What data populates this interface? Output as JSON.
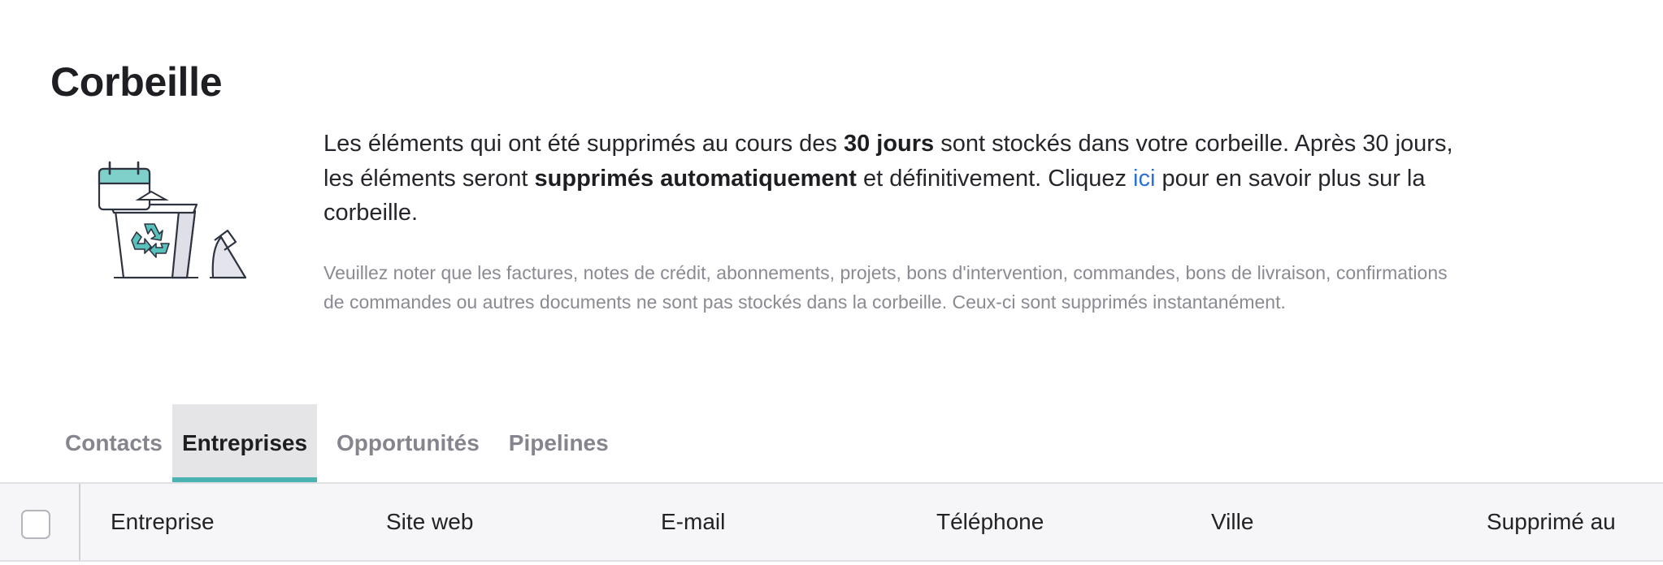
{
  "page": {
    "title": "Corbeille"
  },
  "intro": {
    "text_1": "Les éléments qui ont été supprimés au cours des ",
    "bold_1": "30 jours",
    "text_2": " sont stockés dans votre corbeille. Après 30 jours, les éléments seront ",
    "bold_2": "supprimés automatiquement",
    "text_3": " et définitivement. Cliquez ",
    "link": "ici",
    "text_4": " pour en savoir plus sur la corbeille."
  },
  "note": {
    "text": "Veuillez noter que les factures, notes de crédit, abonnements, projets, bons d'intervention, commandes, bons de livraison, confirmations de commandes ou autres documents ne sont pas stockés dans la corbeille. Ceux-ci sont supprimés instantanément."
  },
  "tabs": [
    {
      "label": "Contacts",
      "active": false
    },
    {
      "label": "Entreprises",
      "active": true
    },
    {
      "label": "Opportunités",
      "active": false
    },
    {
      "label": "Pipelines",
      "active": false
    }
  ],
  "table": {
    "columns": [
      "Entreprise",
      "Site web",
      "E-mail",
      "Téléphone",
      "Ville",
      "Supprimé au"
    ]
  },
  "icons": {
    "illustration": "trash-bin-recycle-icon",
    "checkbox": "checkbox-icon"
  },
  "colors": {
    "accent": "#4ab2b0",
    "link": "#2e6fd6",
    "muted_text": "#8a8b92",
    "active_tab_bg": "#e5e5e7",
    "header_bg": "#f6f6f8"
  }
}
